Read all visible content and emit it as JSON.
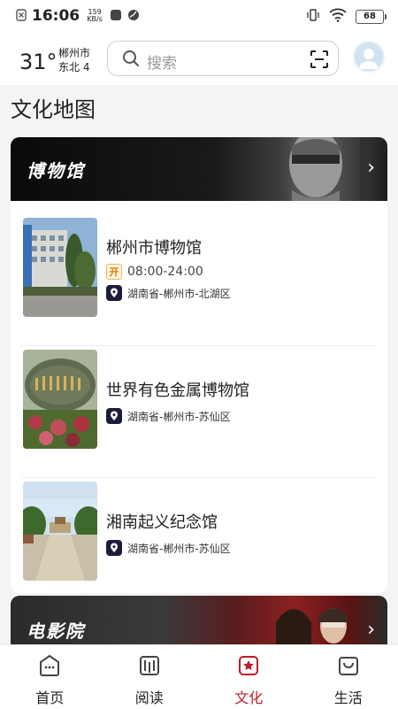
{
  "status_bar": {
    "time": "16:06",
    "net_speed_value": "159",
    "net_speed_unit": "KB/s",
    "battery": "68"
  },
  "header": {
    "temperature": "31°",
    "city": "郴州市",
    "wind": "东北 4",
    "search_placeholder": "搜索"
  },
  "page_title": "文化地图",
  "museum_section": {
    "title": "博物馆",
    "items": [
      {
        "name": "郴州市博物馆",
        "hours_badge": "开",
        "hours": "08:00-24:00",
        "address": "湖南省-郴州市-北湖区"
      },
      {
        "name": "世界有色金属博物馆",
        "address": "湖南省-郴州市-苏仙区"
      },
      {
        "name": "湘南起义纪念馆",
        "address": "湖南省-郴州市-苏仙区"
      }
    ]
  },
  "cinema_section": {
    "title": "电影院"
  },
  "bottom_nav": [
    {
      "label": "首页",
      "icon": "home-icon"
    },
    {
      "label": "阅读",
      "icon": "book-icon"
    },
    {
      "label": "文化",
      "icon": "culture-icon",
      "active": true
    },
    {
      "label": "生活",
      "icon": "shopping-bag-icon"
    }
  ],
  "colors": {
    "accent": "#c01c2c",
    "banner_dark": "#111111"
  }
}
